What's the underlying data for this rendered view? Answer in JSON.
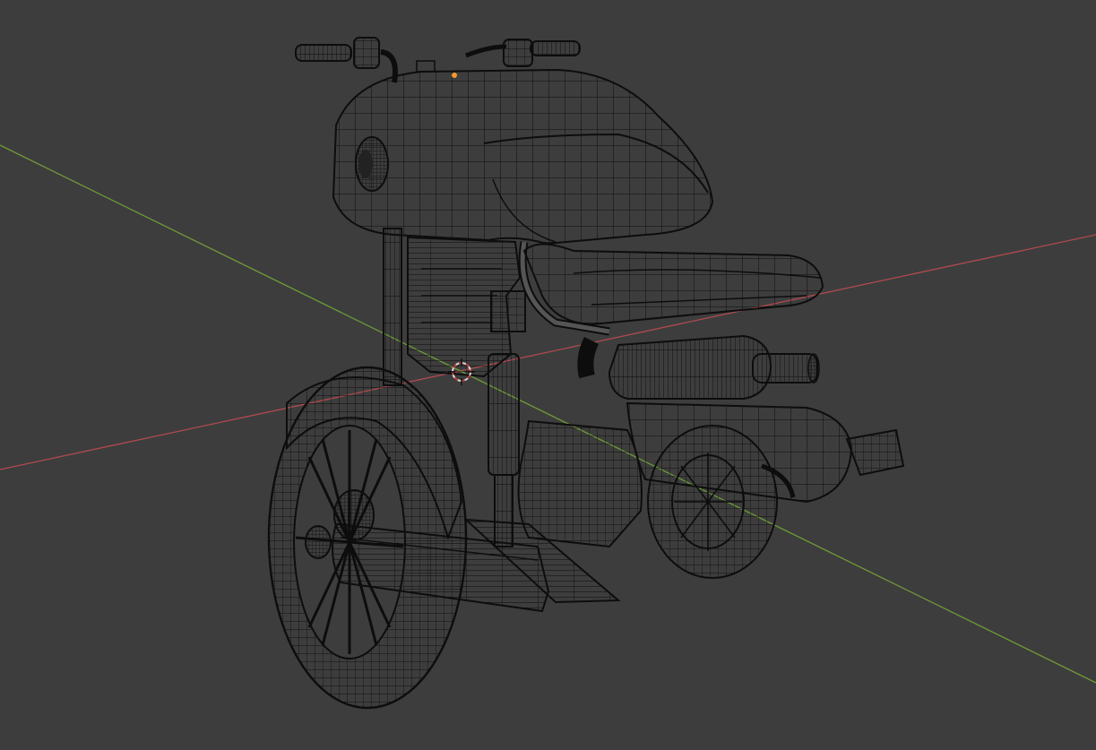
{
  "viewport": {
    "background": "#3d3d3d",
    "wire_color": "#0d0d0d",
    "mesh_fill": "#404040",
    "x_axis_color": "#b04a50",
    "y_axis_color": "#6f9a38",
    "origin_color": "#f09b2b",
    "cursor_colors": [
      "#d9d9d9",
      "#c33a3a"
    ]
  },
  "scene": {
    "object": "motorcycle-wireframe-mesh",
    "display_mode": "wireframe",
    "icons": [
      "3d-cursor-icon",
      "object-origin-icon"
    ]
  }
}
